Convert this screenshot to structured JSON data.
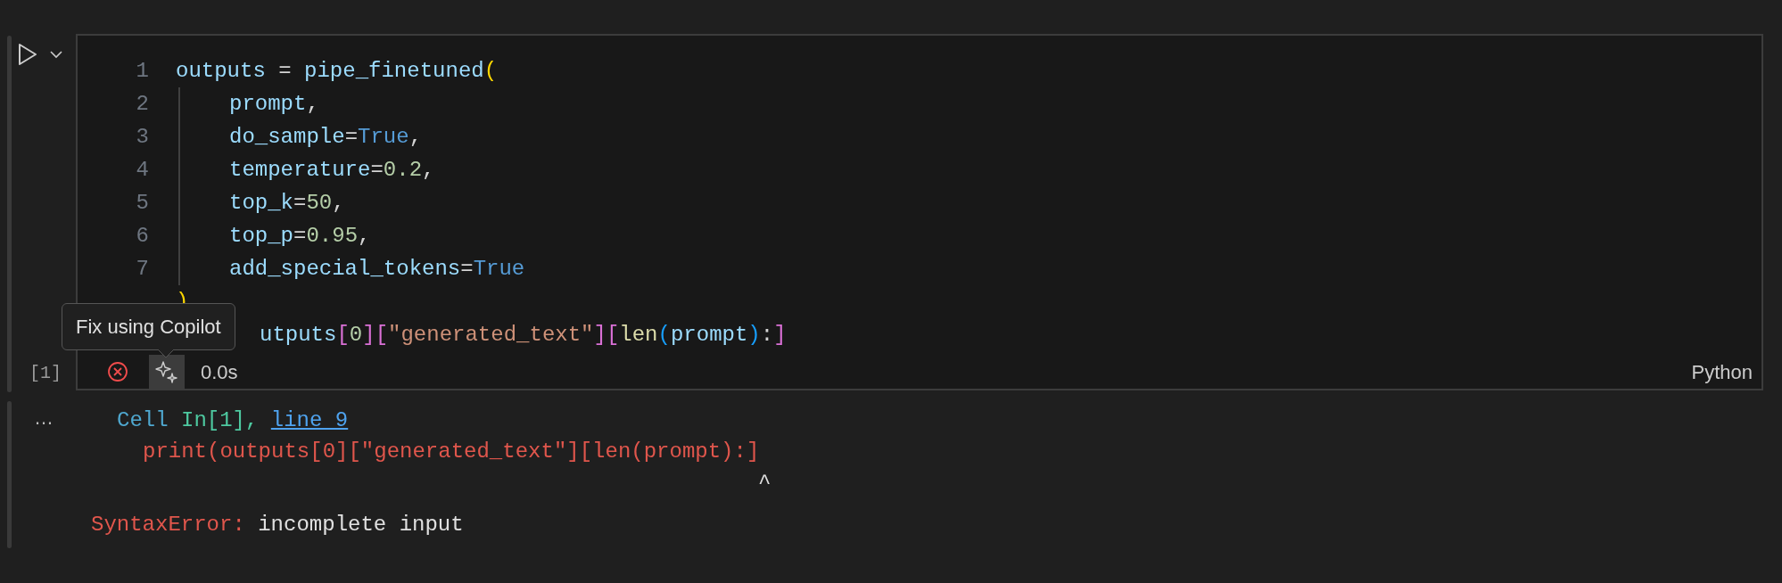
{
  "cell": {
    "execution_count": "[1]",
    "failed": true,
    "duration": "0.0s",
    "language": "Python",
    "tooltip": "Fix using Copilot",
    "lines": [
      {
        "number": "1",
        "tokens": [
          {
            "text": "outputs",
            "kind": "var"
          },
          {
            "text": " = ",
            "kind": "op"
          },
          {
            "text": "pipe_finetuned",
            "kind": "var"
          },
          {
            "text": "(",
            "kind": "paren"
          }
        ]
      },
      {
        "number": "2",
        "indented": true,
        "tokens": [
          {
            "text": "prompt",
            "kind": "var"
          },
          {
            "text": ",",
            "kind": "op"
          }
        ]
      },
      {
        "number": "3",
        "indented": true,
        "tokens": [
          {
            "text": "do_sample",
            "kind": "var"
          },
          {
            "text": "=",
            "kind": "op"
          },
          {
            "text": "True",
            "kind": "kw"
          },
          {
            "text": ",",
            "kind": "op"
          }
        ]
      },
      {
        "number": "4",
        "indented": true,
        "tokens": [
          {
            "text": "temperature",
            "kind": "var"
          },
          {
            "text": "=",
            "kind": "op"
          },
          {
            "text": "0.2",
            "kind": "num"
          },
          {
            "text": ",",
            "kind": "op"
          }
        ]
      },
      {
        "number": "5",
        "indented": true,
        "tokens": [
          {
            "text": "top_k",
            "kind": "var"
          },
          {
            "text": "=",
            "kind": "op"
          },
          {
            "text": "50",
            "kind": "num"
          },
          {
            "text": ",",
            "kind": "op"
          }
        ]
      },
      {
        "number": "6",
        "indented": true,
        "tokens": [
          {
            "text": "top_p",
            "kind": "var"
          },
          {
            "text": "=",
            "kind": "op"
          },
          {
            "text": "0.95",
            "kind": "num"
          },
          {
            "text": ",",
            "kind": "op"
          }
        ]
      },
      {
        "number": "7",
        "indented": true,
        "tokens": [
          {
            "text": "add_special_tokens",
            "kind": "var"
          },
          {
            "text": "=",
            "kind": "op"
          },
          {
            "text": "True",
            "kind": "kw"
          }
        ]
      },
      {
        "tokens": [
          {
            "text": ")",
            "kind": "paren"
          }
        ]
      },
      {
        "covered": true,
        "tokens": [
          {
            "text": "utputs",
            "kind": "var"
          },
          {
            "text": "[",
            "kind": "bracket"
          },
          {
            "text": "0",
            "kind": "num"
          },
          {
            "text": "]",
            "kind": "bracket"
          },
          {
            "text": "[",
            "kind": "bracket"
          },
          {
            "text": "\"generated_text\"",
            "kind": "str"
          },
          {
            "text": "]",
            "kind": "bracket"
          },
          {
            "text": "[",
            "kind": "bracket"
          },
          {
            "text": "len",
            "kind": "func"
          },
          {
            "text": "(",
            "kind": "paren2"
          },
          {
            "text": "prompt",
            "kind": "var"
          },
          {
            "text": ")",
            "kind": "paren2"
          },
          {
            "text": ":",
            "kind": "op"
          },
          {
            "text": "]",
            "kind": "bracket"
          }
        ]
      }
    ]
  },
  "output": {
    "more": "…",
    "location": {
      "file": "Cell",
      "cell": "In[1],",
      "link": "line 9"
    },
    "source_line": "print(outputs[0][\"generated_text\"][len(prompt):]",
    "caret": "^",
    "error_type": "SyntaxError:",
    "error_message": "incomplete input"
  }
}
